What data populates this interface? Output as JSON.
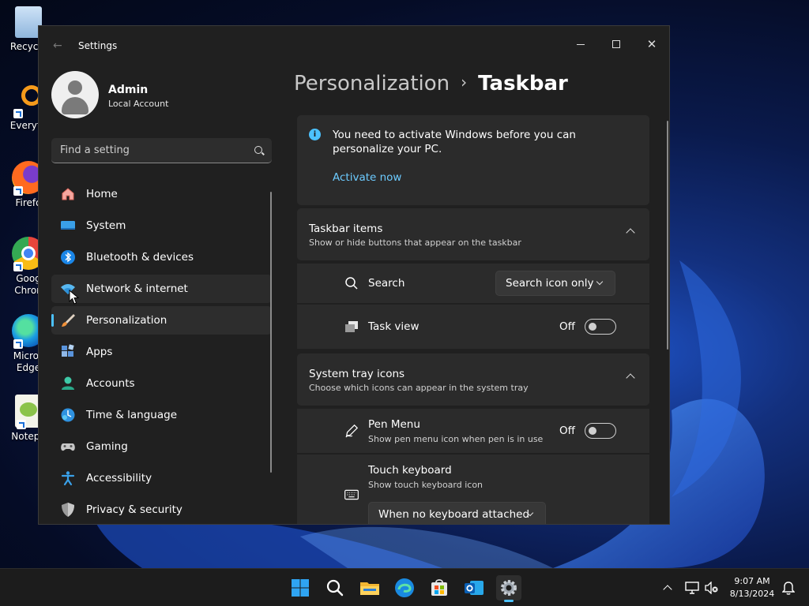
{
  "desktop": {
    "icons": [
      {
        "label": "Recycle",
        "icon": "recycle-bin-icon"
      },
      {
        "label": "Everyth",
        "icon": "everything-search-icon"
      },
      {
        "label": "Firefo",
        "icon": "firefox-icon"
      },
      {
        "label": "Goog\nChron",
        "icon": "chrome-icon"
      },
      {
        "label": "Micros\nEdge",
        "icon": "edge-icon"
      },
      {
        "label": "Notepa",
        "icon": "notepad-plus-plus-icon"
      }
    ]
  },
  "window": {
    "title": "Settings",
    "controls": {
      "minimize": "minimize-icon",
      "maximize": "maximize-icon",
      "close": "close-icon"
    }
  },
  "profile": {
    "name": "Admin",
    "subtitle": "Local Account"
  },
  "search": {
    "placeholder": "Find a setting"
  },
  "nav": {
    "items": [
      {
        "label": "Home",
        "icon": "home-icon"
      },
      {
        "label": "System",
        "icon": "system-icon"
      },
      {
        "label": "Bluetooth & devices",
        "icon": "bluetooth-icon"
      },
      {
        "label": "Network & internet",
        "icon": "wifi-icon"
      },
      {
        "label": "Personalization",
        "icon": "brush-icon"
      },
      {
        "label": "Apps",
        "icon": "apps-icon"
      },
      {
        "label": "Accounts",
        "icon": "accounts-icon"
      },
      {
        "label": "Time & language",
        "icon": "globe-clock-icon"
      },
      {
        "label": "Gaming",
        "icon": "gamepad-icon"
      },
      {
        "label": "Accessibility",
        "icon": "accessibility-icon"
      },
      {
        "label": "Privacy & security",
        "icon": "shield-icon"
      }
    ],
    "active": "Personalization",
    "hovered": "Network & internet"
  },
  "breadcrumb": {
    "parent": "Personalization",
    "separator": "›",
    "current": "Taskbar"
  },
  "activation": {
    "message": "You need to activate Windows before you can personalize your PC.",
    "link": "Activate now"
  },
  "taskbar_items": {
    "title": "Taskbar items",
    "subtitle": "Show or hide buttons that appear on the taskbar",
    "search": {
      "label": "Search",
      "value": "Search icon only"
    },
    "task_view": {
      "label": "Task view",
      "state": "Off"
    }
  },
  "system_tray": {
    "title": "System tray icons",
    "subtitle": "Choose which icons can appear in the system tray",
    "pen_menu": {
      "label": "Pen Menu",
      "subtitle": "Show pen menu icon when pen is in use",
      "state": "Off"
    },
    "touch_keyboard": {
      "label": "Touch keyboard",
      "subtitle": "Show touch keyboard icon",
      "value": "When no keyboard attached"
    }
  },
  "system_taskbar": {
    "apps": [
      "start-icon",
      "search-icon",
      "file-explorer-icon",
      "edge-icon",
      "store-icon",
      "outlook-icon",
      "settings-icon"
    ],
    "tray": [
      "chevron-up-icon",
      "network-icon",
      "volume-muted-icon",
      "notification-bell-icon"
    ],
    "time": "9:07 AM",
    "date": "8/13/2024"
  },
  "colors": {
    "accent": "#4cc2ff",
    "link": "#6ccbff",
    "window_bg": "#202020",
    "card_bg": "#2b2b2b"
  }
}
